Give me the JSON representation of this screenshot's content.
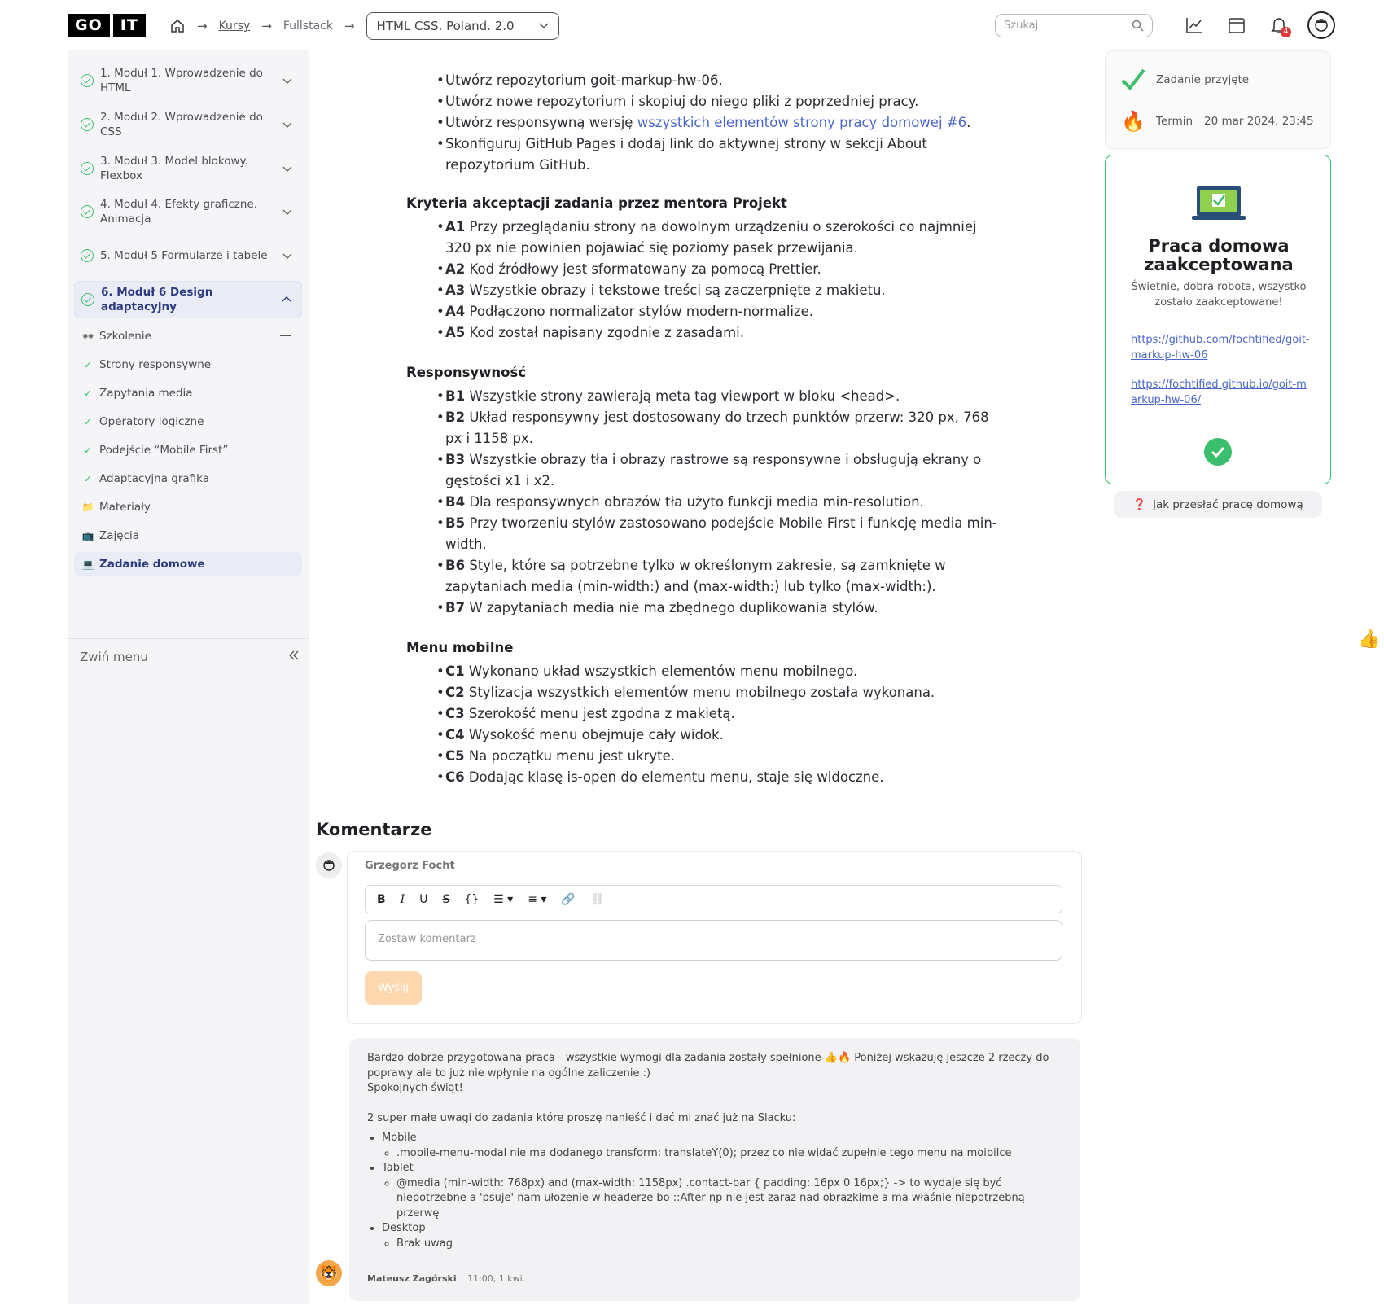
{
  "header": {
    "logo_left": "GO",
    "logo_right": "IT",
    "breadcrumbs": [
      "Kursy",
      "Fullstack"
    ],
    "course_select": "HTML CSS. Poland. 2.0",
    "search_placeholder": "Szukaj",
    "notification_count": "4"
  },
  "sidebar": {
    "modules": [
      {
        "label": "1. Moduł 1. Wprowadzenie do HTML"
      },
      {
        "label": "2. Moduł 2. Wprowadzenie do CSS"
      },
      {
        "label": "3. Moduł 3. Model blokowy. Flexbox"
      },
      {
        "label": "4. Moduł 4. Efekty graficzne. Animacja"
      },
      {
        "label": "5. Moduł 5 Formularze i tabele"
      },
      {
        "label": "6. Moduł 6 Design adaptacyjny"
      }
    ],
    "subitems": [
      {
        "icon": "🕶",
        "label": "Szkolenie"
      },
      {
        "icon": "✓",
        "label": "Strony responsywne"
      },
      {
        "icon": "✓",
        "label": "Zapytania media"
      },
      {
        "icon": "✓",
        "label": "Operatory logiczne"
      },
      {
        "icon": "✓",
        "label": "Podejście “Mobile First”"
      },
      {
        "icon": "✓",
        "label": "Adaptacyjna grafika"
      },
      {
        "icon": "📁",
        "label": "Materiały"
      },
      {
        "icon": "📺",
        "label": "Zajęcia"
      },
      {
        "icon": "💻",
        "label": "Zadanie domowe"
      }
    ],
    "collapse_label": "Zwiń menu"
  },
  "task": {
    "intro": [
      "Utwórz repozytorium goit-markup-hw-06.",
      "Utwórz nowe repozytorium i skopiuj do niego pliki z poprzedniej pracy.",
      "Skonfiguruj GitHub Pages i dodaj link do aktywnej strony w sekcji About repozytorium GitHub."
    ],
    "intro_link_prefix": "Utwórz responsywną wersję ",
    "intro_link": "wszystkich elementów strony pracy domowej #6",
    "intro_link_suffix": ".",
    "sections": [
      {
        "title": "Kryteria akceptacji zadania przez mentora Projekt",
        "items": [
          {
            "code": "A1",
            "text": "Przy przeglądaniu strony na dowolnym urządzeniu o szerokości co najmniej 320 px nie powinien pojawiać się poziomy pasek przewijania."
          },
          {
            "code": "A2",
            "text": "Kod źródłowy jest sformatowany za pomocą Prettier."
          },
          {
            "code": "A3",
            "text": "Wszystkie obrazy i tekstowe treści są zaczerpnięte z makietu."
          },
          {
            "code": "A4",
            "text": "Podłączono normalizator stylów modern-normalize."
          },
          {
            "code": "A5",
            "text": "Kod został napisany zgodnie z zasadami."
          }
        ]
      },
      {
        "title": "Responsywność",
        "items": [
          {
            "code": "B1",
            "text": "Wszystkie strony zawierają meta tag viewport w bloku <head>."
          },
          {
            "code": "B2",
            "text": "Układ responsywny jest dostosowany do trzech punktów przerw: 320 px, 768 px i 1158 px."
          },
          {
            "code": "B3",
            "text": "Wszystkie obrazy tła i obrazy rastrowe są responsywne i obsługują ekrany o gęstości x1 i x2."
          },
          {
            "code": "B4",
            "text": "Dla responsywnych obrazów tła użyto funkcji media min-resolution."
          },
          {
            "code": "B5",
            "text": "Przy tworzeniu stylów zastosowano podejście Mobile First i funkcję media min-width."
          },
          {
            "code": "B6",
            "text": "Style, które są potrzebne tylko w określonym zakresie, są zamknięte w zapytaniach media (min-width:) and (max-width:) lub tylko (max-width:)."
          },
          {
            "code": "B7",
            "text": "W zapytaniach media nie ma zbędnego duplikowania stylów."
          }
        ]
      },
      {
        "title": "Menu mobilne",
        "items": [
          {
            "code": "C1",
            "text": "Wykonano układ wszystkich elementów menu mobilnego."
          },
          {
            "code": "C2",
            "text": "Stylizacja wszystkich elementów menu mobilnego została wykonana."
          },
          {
            "code": "C3",
            "text": "Szerokość menu jest zgodna z makietą."
          },
          {
            "code": "C4",
            "text": "Wysokość menu obejmuje cały widok."
          },
          {
            "code": "C5",
            "text": "Na początku menu jest ukryte."
          },
          {
            "code": "C6",
            "text": "Dodając klasę is-open do elementu menu, staje się widoczne."
          }
        ]
      }
    ]
  },
  "comments": {
    "heading": "Komentarze",
    "author": "Grzegorz Focht",
    "input_placeholder": "Zostaw komentarz",
    "send_label": "Wyślij",
    "reply": {
      "line1": "Bardzo dobrze przygotowana praca - wszystkie wymogi dla zadania zostały spełnione 👍🔥 Poniżej wskazuję jeszcze 2 rzeczy do poprawy ale to już nie wpłynie na ogólne zaliczenie :)",
      "line2": "Spokojnych świąt!",
      "line3": "2 super małe uwagi do zadania które proszę nanieść i dać mi znać już na Slacku:",
      "mobile": "Mobile",
      "mobile_note": ".mobile-menu-modal nie ma dodanego transform: translateY(0); przez co nie widać zupełnie tego menu na moibilce",
      "tablet": "Tablet",
      "tablet_note": "@media (min-width: 768px) and (max-width: 1158px) .contact-bar {    padding: 16px 0 16px;} -> to wydaje się być niepotrzebne a 'psuje' nam ułożenie w headerze bo ::After np nie jest zaraz nad obrazkime a ma właśnie niepotrzebną przerwę",
      "desktop": "Desktop",
      "desktop_note": "Brak uwag",
      "author": "Mateusz Zagórski",
      "time": "11:00, 1 kwi."
    }
  },
  "status": {
    "accepted_label": "Zadanie przyjęte",
    "deadline_label": "Termin",
    "deadline_value": "20 mar 2024, 23:45",
    "card_title": "Praca domowa zaakceptowana",
    "card_desc": "Świetnie, dobra robota, wszystko zostało zaakceptowane!",
    "link1": "https://github.com/fochtified/goit-markup-hw-06",
    "link2": "https://fochtified.github.io/goit-markup-hw-06/",
    "how_to_label": "Jak przesłać pracę domową",
    "how_to_icon": "❓"
  },
  "colors": {
    "accent": "#3bbf6c",
    "link": "#4a66c8",
    "send": "#ffd8b0"
  }
}
